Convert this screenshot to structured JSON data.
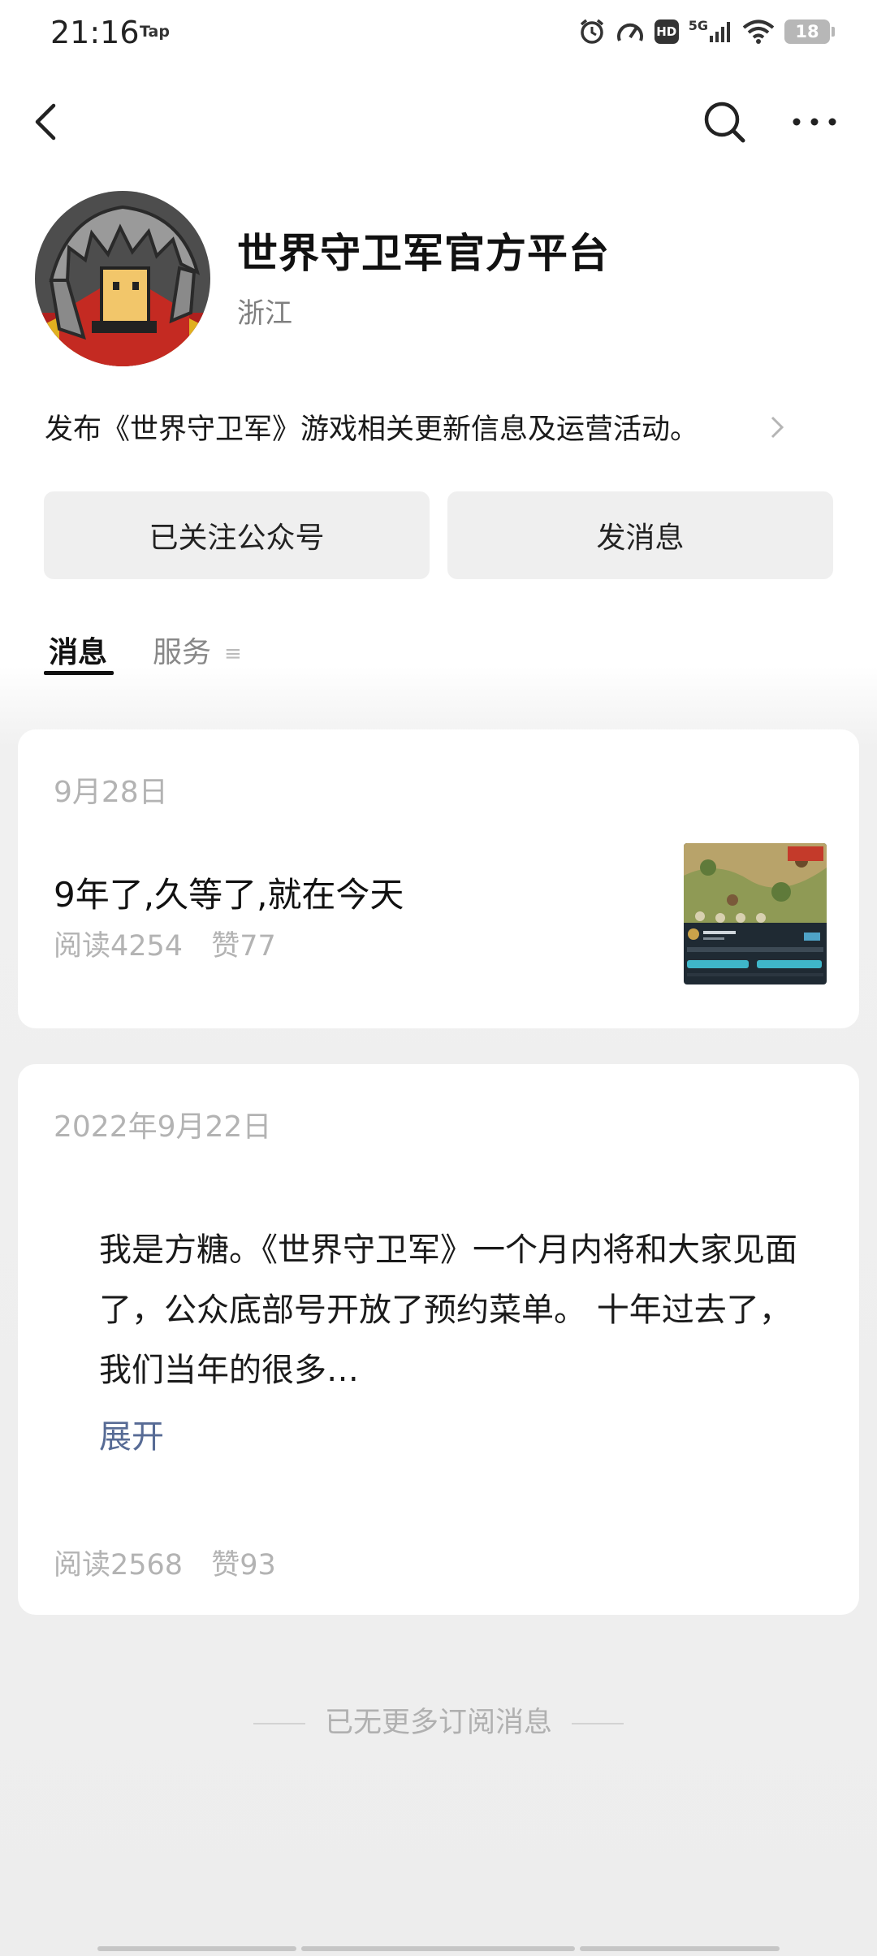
{
  "status_bar": {
    "time": "21:16",
    "tap_label": "Tap",
    "hd_label": "HD",
    "network_label": "5G",
    "battery": "18"
  },
  "nav": {
    "back_icon": "back-arrow-icon",
    "search_icon": "search-icon",
    "more_icon": "more-dots-icon"
  },
  "profile": {
    "name": "世界守卫军官方平台",
    "region": "浙江",
    "description": "发布《世界守卫军》游戏相关更新信息及运营活动。"
  },
  "actions": {
    "follow_label": "已关注公众号",
    "message_label": "发消息"
  },
  "tabs": {
    "messages": "消息",
    "services": "服务",
    "services_menu_glyph": "≡"
  },
  "posts": [
    {
      "date": "9月28日",
      "title": "9年了,久等了,就在今天",
      "reads": "阅读4254",
      "likes": "赞77"
    },
    {
      "date": "2022年9月22日",
      "body": "我是方糖。《世界守卫军》一个月内将和大家见面了，公众底部号开放了预约菜单。 十年过去了， 我们当年的很多…",
      "expand": "展开",
      "reads": "阅读2568",
      "likes": "赞93"
    }
  ],
  "end_note": "已无更多订阅消息",
  "colors": {
    "link": "#576b95",
    "muted": "#b3b3b3",
    "button_bg": "#efefef"
  }
}
